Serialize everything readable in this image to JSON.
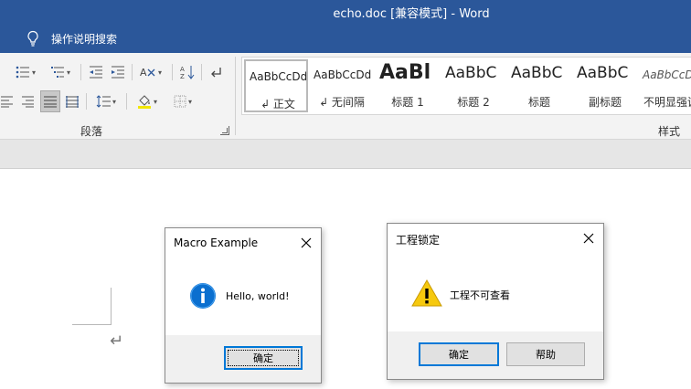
{
  "window": {
    "title": "echo.doc [兼容模式]  -  Word"
  },
  "tell_me": {
    "label": "操作说明搜索"
  },
  "ribbon": {
    "paragraph_group": {
      "label": "段落"
    },
    "styles_group": {
      "label": "样式",
      "items": [
        {
          "preview": "AaBbCcDd",
          "name": "↲ 正文",
          "selected": true
        },
        {
          "preview": "AaBbCcDd",
          "name": "↲ 无间隔"
        },
        {
          "preview": "AaBl",
          "name": "标题 1"
        },
        {
          "preview": "AaBbC",
          "name": "标题 2"
        },
        {
          "preview": "AaBbC",
          "name": "标题"
        },
        {
          "preview": "AaBbC",
          "name": "副标题"
        },
        {
          "preview": "AaBbCcD",
          "name": "不明显强调"
        }
      ]
    }
  },
  "document": {
    "paragraph_mark": "↵"
  },
  "dialogs": {
    "macro": {
      "title": "Macro Example",
      "message": "Hello, world!",
      "ok_label": "确定",
      "icon": "info-icon"
    },
    "lock": {
      "title": "工程锁定",
      "message": "工程不可查看",
      "ok_label": "确定",
      "help_label": "帮助",
      "icon": "warning-icon"
    }
  },
  "colors": {
    "title_bar": "#2b579a",
    "info_blue": "#0b6fcf",
    "warning_yellow": "#f6c90e",
    "default_button_border": "#0078d7"
  }
}
